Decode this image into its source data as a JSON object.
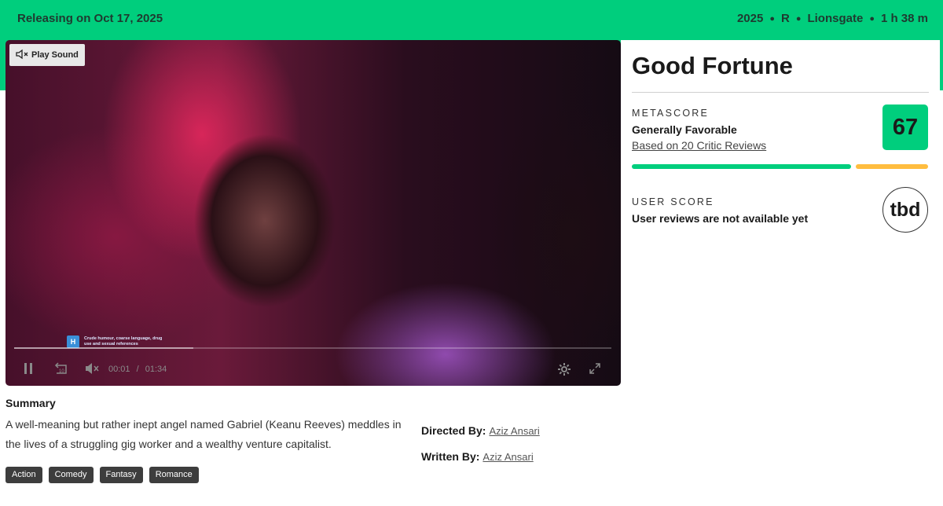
{
  "header": {
    "release": "Releasing on Oct 17, 2025",
    "year": "2025",
    "rating": "R",
    "studio": "Lionsgate",
    "runtime": "1 h 38 m"
  },
  "player": {
    "sound_label": "Play Sound",
    "rating_icon_text": "H",
    "rating_notice": "Crude humour, coarse language, drug use and sexual references",
    "current_time": "00:01",
    "time_separator": "/",
    "duration": "01:34",
    "progress_fraction": 0.3
  },
  "movie": {
    "title": "Good Fortune",
    "summary_heading": "Summary",
    "summary": "A well-meaning but rather inept angel named Gabriel (Keanu Reeves) meddles in the lives of a struggling gig worker and a wealthy venture capitalist.",
    "directed_label": "Directed By:",
    "director": "Aziz Ansari",
    "written_label": "Written By:",
    "writer": "Aziz Ansari",
    "genres": [
      "Action",
      "Comedy",
      "Fantasy",
      "Romance"
    ]
  },
  "scores": {
    "metascore_label": "METASCORE",
    "metascore_desc": "Generally Favorable",
    "metascore_link": "Based on 20 Critic Reviews",
    "metascore_value": "67",
    "user_label": "USER SCORE",
    "user_desc": "User reviews are not available yet",
    "user_value": "tbd"
  },
  "colors": {
    "brand_green": "#00ce7d",
    "mixed_yellow": "#ffbd3f"
  },
  "icons": [
    "mute-icon",
    "pause-icon",
    "replay-10-icon",
    "volume-icon",
    "settings-icon",
    "fullscreen-icon"
  ]
}
